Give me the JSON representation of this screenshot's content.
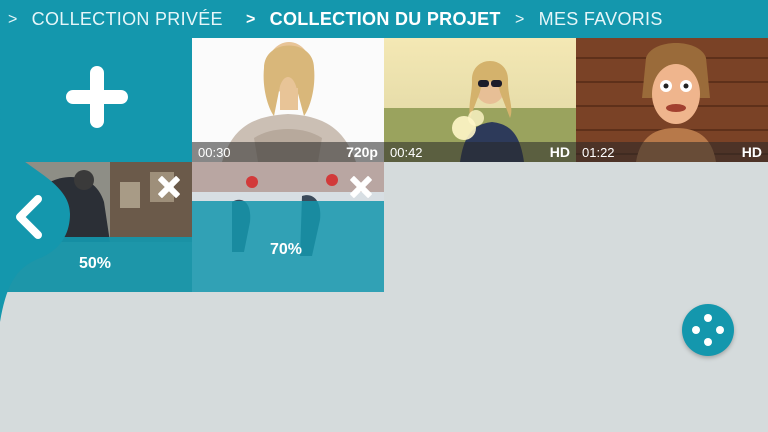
{
  "breadcrumbs": [
    {
      "chevron": ">",
      "label": "COLLECTION PRIVÉE"
    },
    {
      "chevron": ">",
      "label": "COLLECTION DU PROJET"
    },
    {
      "chevron": ">",
      "label": "MES FAVORIS"
    }
  ],
  "videos": [
    {
      "duration": "00:30",
      "quality": "720p"
    },
    {
      "duration": "00:42",
      "quality": "HD"
    },
    {
      "duration": "01:22",
      "quality": "HD"
    }
  ],
  "uploads": [
    {
      "progress": "50%",
      "progress_value": 50
    },
    {
      "progress": "70%",
      "progress_value": 70
    }
  ],
  "icons": {
    "add": "plus-icon",
    "back": "chevron-left-icon",
    "cancel": "close-icon",
    "fab": "share-dots-icon"
  },
  "colors": {
    "accent": "#1497ad",
    "background": "#d5dbdc"
  }
}
